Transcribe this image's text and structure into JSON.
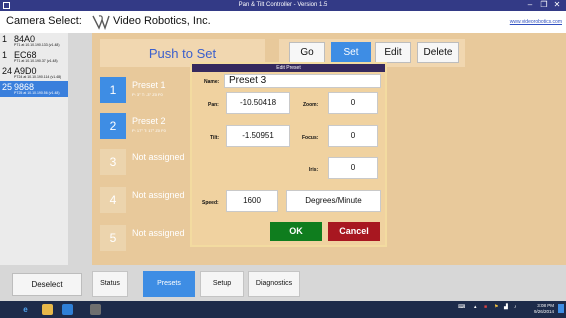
{
  "window": {
    "title": "Pan & Tilt Controller - Version 1.5",
    "minimize": "–",
    "maximize": "❐",
    "close": "✕"
  },
  "header": {
    "camera_select_label": "Camera Select:",
    "company": "Video Robotics, Inc.",
    "site_link": "www.videorobotics.com"
  },
  "cameras": [
    {
      "num": "1",
      "name": "84A0",
      "ip": "PT1 at 10.10.190.133 (v1.48)",
      "selected": false
    },
    {
      "num": "1",
      "name": "EC68",
      "ip": "PT1 at 10.10.190.37 (v1.48)",
      "selected": false
    },
    {
      "num": "24",
      "name": "A9D0",
      "ip": "PT24 at 10.10.190.114 (v1.48)",
      "selected": false
    },
    {
      "num": "25",
      "name": "9868",
      "ip": "PT25 at 10.10.190.56 (v1.48)",
      "selected": true
    }
  ],
  "push_panel": {
    "title": "Push to Set"
  },
  "mode_buttons": {
    "go": "Go",
    "set": "Set",
    "edit": "Edit",
    "delete": "Delete"
  },
  "presets": [
    {
      "num": "1",
      "label": "Preset 1",
      "sub": "P: 3°  T: -3°  Z0  F0",
      "assigned": true
    },
    {
      "num": "2",
      "label": "Preset 2",
      "sub": "P: 17°  T: 17°  Z0  F0",
      "assigned": true
    },
    {
      "num": "3",
      "label": "Not assigned",
      "sub": "",
      "assigned": false
    },
    {
      "num": "4",
      "label": "Not assigned",
      "sub": "",
      "assigned": false
    },
    {
      "num": "5",
      "label": "Not assigned",
      "sub": "",
      "assigned": false
    }
  ],
  "edit_dialog": {
    "title": "Edit Preset",
    "name_label": "Name:",
    "name_value": "Preset 3",
    "pan_label": "Pan:",
    "pan_value": "-10.50418",
    "zoom_label": "Zoom:",
    "zoom_value": "0",
    "tilt_label": "Tilt:",
    "tilt_value": "-1.50951",
    "focus_label": "Focus:",
    "focus_value": "0",
    "iris_label": "Iris:",
    "iris_value": "0",
    "speed_label": "Speed:",
    "speed_value": "1600",
    "speed_units": "Degrees/Minute",
    "ok": "OK",
    "cancel": "Cancel"
  },
  "bottom": {
    "deselect": "Deselect",
    "tabs": [
      {
        "label": "Status",
        "active": false
      },
      {
        "label": "Presets",
        "active": true
      },
      {
        "label": "Setup",
        "active": false
      },
      {
        "label": "Diagnostics",
        "active": false
      }
    ]
  },
  "taskbar": {
    "time": "3:08 PM",
    "date": "9/26/2014"
  },
  "colors": {
    "accent": "#3e8de4",
    "panel": "#e8c99b",
    "ok": "#0f7d1e",
    "cancel": "#a81720",
    "titlebar": "#333a86"
  }
}
